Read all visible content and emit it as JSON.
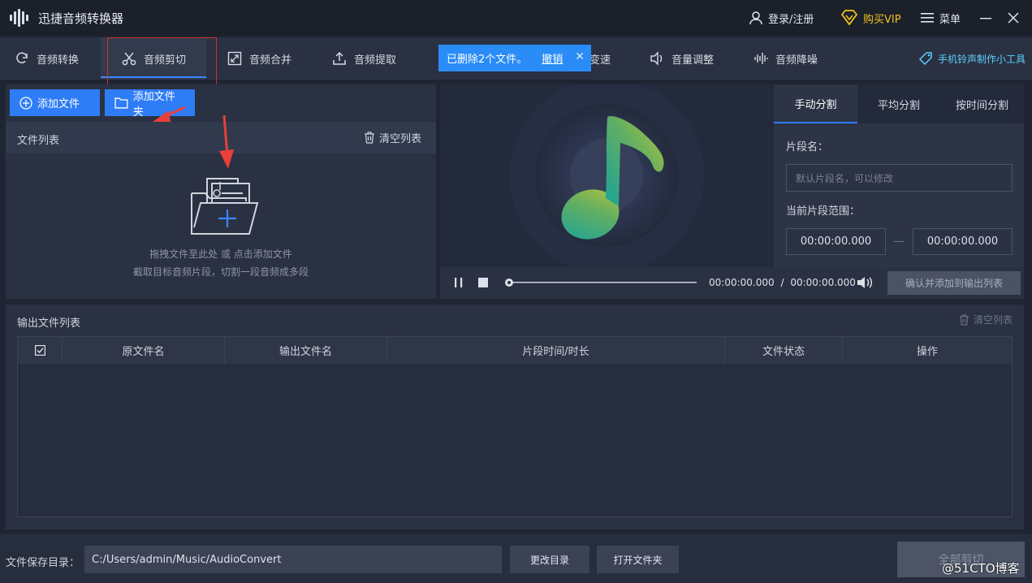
{
  "app": {
    "title": "迅捷音频转换器"
  },
  "titlebar": {
    "login": "登录/注册",
    "vip": "购买VIP",
    "menu": "菜单"
  },
  "toolbar": {
    "tabs": [
      {
        "label": "音频转换",
        "icon": "refresh-icon"
      },
      {
        "label": "音频剪切",
        "icon": "scissors-icon",
        "active": true
      },
      {
        "label": "音频合并",
        "icon": "merge-icon"
      },
      {
        "label": "音频提取",
        "icon": "upload-icon"
      },
      {
        "label": "变速",
        "icon": "speed-icon"
      },
      {
        "label": "音量调整",
        "icon": "volume-icon"
      },
      {
        "label": "音频降噪",
        "icon": "waveform-icon"
      }
    ],
    "ringtone_link": "手机铃声制作小工具"
  },
  "toast": {
    "message": "已删除2个文件。",
    "undo": "撤销",
    "close": "✕"
  },
  "file_panel": {
    "add_file": "添加文件",
    "add_folder": "添加文件夹",
    "list_title": "文件列表",
    "clear_list": "清空列表",
    "drop_hint": "拖拽文件至此处 或 点击添加文件",
    "drop_sub": "截取目标音频片段，切割一段音频成多段"
  },
  "player": {
    "current_time": "00:00:00.000",
    "separator": "/",
    "total_time": "00:00:00.000",
    "confirm": "确认并添加到输出列表",
    "progress": 0
  },
  "split_panel": {
    "tabs": [
      "手动分割",
      "平均分割",
      "按时间分割"
    ],
    "segment_name_label": "片段名：",
    "segment_name_placeholder": "默认片段名，可以修改",
    "range_label": "当前片段范围：",
    "range_start": "00:00:00.000",
    "range_end": "00:00:00.000"
  },
  "output": {
    "title": "输出文件列表",
    "clear_list": "清空列表",
    "columns": [
      "原文件名",
      "输出文件名",
      "片段时间/时长",
      "文件状态",
      "操作"
    ],
    "select_all_checked": true
  },
  "bottom": {
    "save_dir_label": "文件保存目录：",
    "save_dir": "C:/Users/admin/Music/AudioConvert",
    "change_dir": "更改目录",
    "open_folder": "打开文件夹",
    "cut_all": "全部剪切"
  },
  "watermark": "@51CTO博客",
  "colors": {
    "accent": "#2f7df6",
    "toast": "#2a8cf6",
    "annotation_red": "#d0312d",
    "vip": "#f1c21b",
    "link": "#5fd0ff"
  }
}
